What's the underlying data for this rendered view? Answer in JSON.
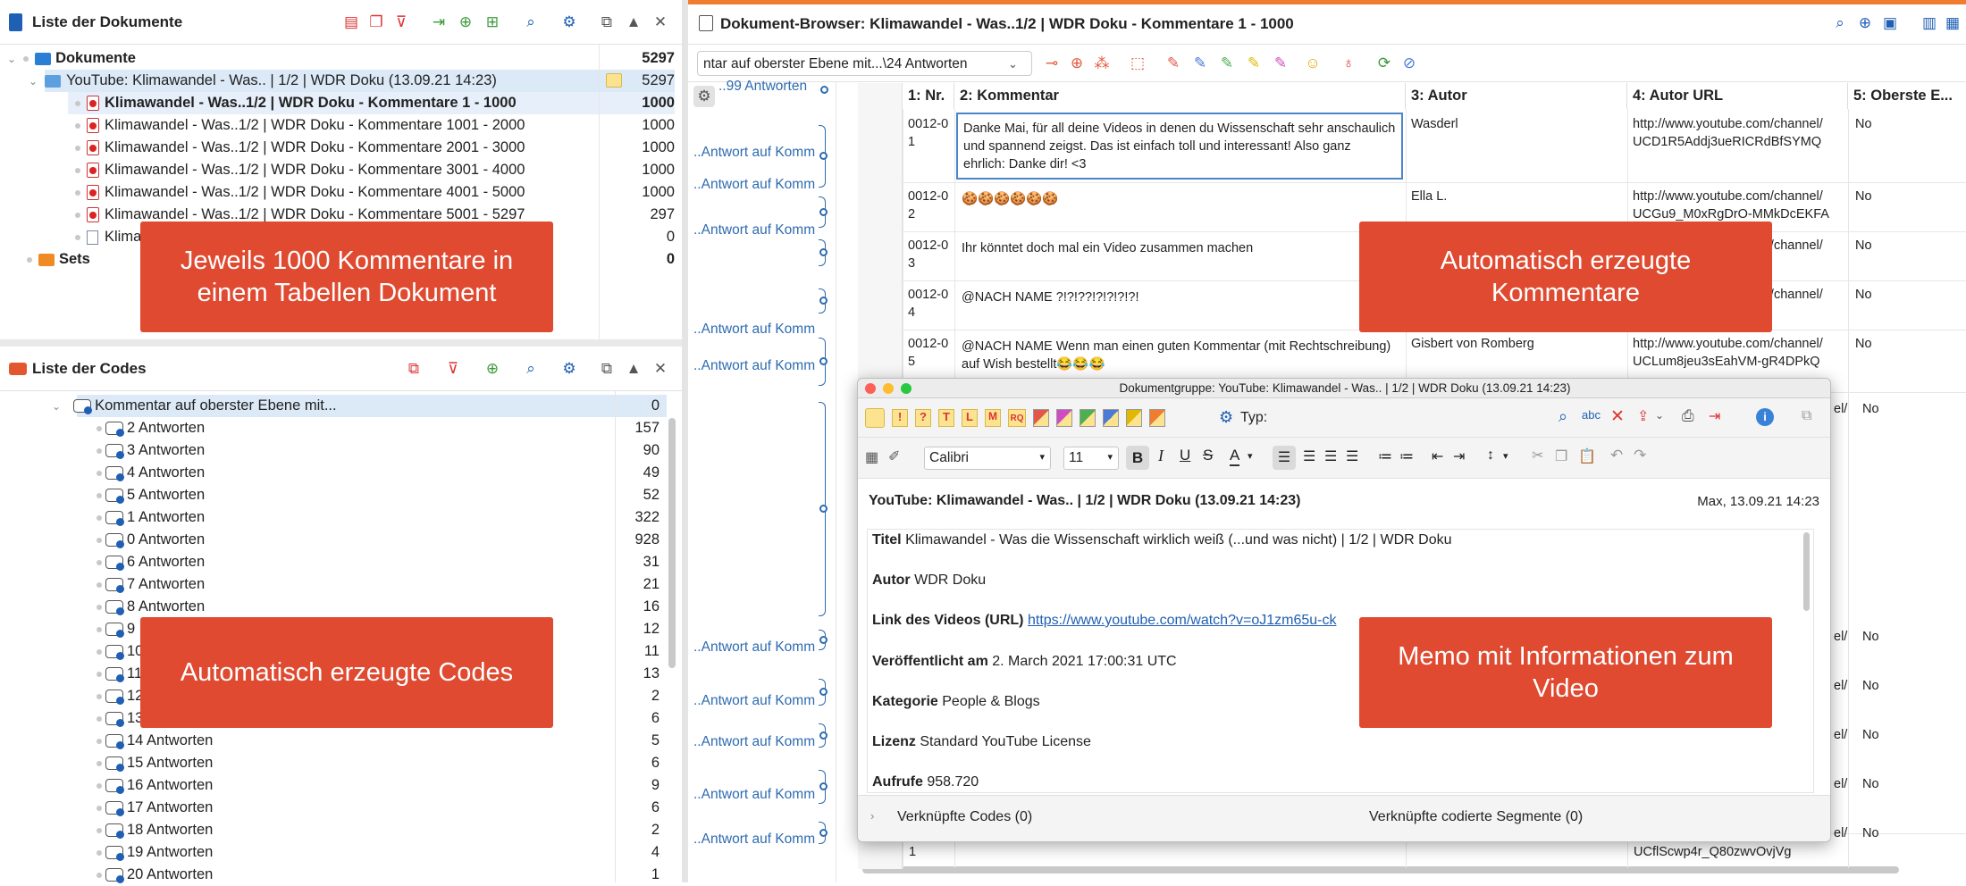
{
  "docs_panel": {
    "title": "Liste der Dokumente"
  },
  "docs_tree": [
    {
      "label": "Dokumente",
      "count": "5297"
    },
    {
      "label": "YouTube: Klimawandel - Was.. | 1/2 | WDR Doku (13.09.21 14:23)",
      "count": "5297"
    },
    {
      "label": "Klimawandel - Was..1/2 | WDR Doku -  Kommentare 1 - 1000",
      "count": "1000"
    },
    {
      "label": "Klimawandel - Was..1/2 | WDR Doku -  Kommentare 1001 - 2000",
      "count": "1000"
    },
    {
      "label": "Klimawandel - Was..1/2 | WDR Doku -  Kommentare 2001 - 3000",
      "count": "1000"
    },
    {
      "label": "Klimawandel - Was..1/2 | WDR Doku -  Kommentare 3001 - 4000",
      "count": "1000"
    },
    {
      "label": "Klimawandel - Was..1/2 | WDR Doku -  Kommentare 4001 - 5000",
      "count": "1000"
    },
    {
      "label": "Klimawandel - Was..1/2 | WDR Doku -  Kommentare 5001 - 5297",
      "count": "297"
    },
    {
      "label": "Klima",
      "count": "0"
    },
    {
      "label": "Sets",
      "count": "0"
    }
  ],
  "codes_panel": {
    "title": "Liste der Codes"
  },
  "codes_tree": [
    {
      "label": "Kommentar auf oberster Ebene mit...",
      "count": "0"
    },
    {
      "label": "2 Antworten",
      "count": "157"
    },
    {
      "label": "3 Antworten",
      "count": "90"
    },
    {
      "label": "4 Antworten",
      "count": "49"
    },
    {
      "label": "5 Antworten",
      "count": "52"
    },
    {
      "label": "1 Antworten",
      "count": "322"
    },
    {
      "label": "0 Antworten",
      "count": "928"
    },
    {
      "label": "6 Antworten",
      "count": "31"
    },
    {
      "label": "7 Antworten",
      "count": "21"
    },
    {
      "label": "8 Antworten",
      "count": "16"
    },
    {
      "label": "9",
      "count": "12"
    },
    {
      "label": "10",
      "count": "11"
    },
    {
      "label": "11",
      "count": "13"
    },
    {
      "label": "12",
      "count": "2"
    },
    {
      "label": "13",
      "count": "6"
    },
    {
      "label": "14 Antworten",
      "count": "5"
    },
    {
      "label": "15 Antworten",
      "count": "6"
    },
    {
      "label": "16 Antworten",
      "count": "9"
    },
    {
      "label": "17 Antworten",
      "count": "6"
    },
    {
      "label": "18 Antworten",
      "count": "2"
    },
    {
      "label": "19 Antworten",
      "count": "4"
    },
    {
      "label": "20 Antworten",
      "count": "1"
    }
  ],
  "browser": {
    "title": "Dokument-Browser: Klimawandel - Was..1/2 | WDR Doku -  Kommentare 1 - 1000",
    "code_select": "ntar auf oberster Ebene mit...\\24 Antworten",
    "margin_first": "..99 Antworten",
    "margin_label": "..Antwort auf Komm",
    "columns": [
      "1: Nr.",
      "2: Kommentar",
      "3: Autor",
      "4: Autor URL",
      "5: Oberste E..."
    ],
    "rows": [
      {
        "idx": "48",
        "nr": "0012-0\n1",
        "text": "Danke Mai, für all deine Videos in denen du Wissenschaft sehr anschaulich und spannend zeigst. Das ist einfach toll und interessant! Also ganz ehrlich: Danke dir! <3",
        "author": "Wasderl",
        "url": "http://www.youtube.com/channel/\nUCD1R5Addj3ueRICRdBfSYMQ",
        "top": "No"
      },
      {
        "idx": "49",
        "nr": "0012-0\n2",
        "text": "🍪🍪🍪🍪🍪🍪",
        "author": "Ella L.",
        "url": "http://www.youtube.com/channel/\nUCGu9_M0xRgDrO-MMkDcEKFA",
        "top": "No"
      },
      {
        "idx": "50",
        "nr": "0012-0\n3",
        "text": "Ihr könntet doch mal ein Video zusammen machen",
        "author": "",
        "url": "http://www.youtube.com/channel/\n5xZAVw",
        "top": "No"
      },
      {
        "idx": "51",
        "nr": "0012-0\n4",
        "text": "@NACH NAME ?!?!??!?!?!?!?!",
        "author": "",
        "url": "http://www.youtube.com/channel/\nHjLkzQ",
        "top": "No"
      },
      {
        "idx": "52",
        "nr": "0012-0\n5",
        "text": "@NACH NAME Wenn man einen guten Kommentar (mit Rechtschreibung) auf Wish bestellt😂😂😂",
        "author": "Gisbert von Romberg",
        "url": "http://www.youtube.com/channel/\nUCLum8jeu3sEahVM-gR4DPkQ",
        "top": "No"
      }
    ],
    "right_fragments": [
      "el/",
      "No",
      "el/",
      "No",
      "el/",
      "No",
      "el/",
      "No",
      "el/",
      "No",
      "el/",
      "No",
      "el/",
      "No"
    ],
    "last_row": {
      "nr": "1",
      "url": "UCflScwp4r_Q80zwvOvjVg"
    }
  },
  "memo": {
    "window_title": "Dokumentgruppe: YouTube: Klimawandel - Was.. | 1/2 | WDR Doku (13.09.21 14:23)",
    "type_label": "Typ:",
    "font_name": "Calibri",
    "font_size": "11",
    "heading": "YouTube: Klimawandel - Was.. | 1/2 | WDR Doku (13.09.21 14:23)",
    "author_date": "Max, 13.09.21 14:23",
    "fields": [
      {
        "key": "Titel",
        "value": "Klimawandel - Was die Wissenschaft wirklich weiß (...und was nicht) | 1/2 | WDR Doku"
      },
      {
        "key": "Autor",
        "value": "WDR Doku"
      },
      {
        "key": "Link des Videos (URL)",
        "value": "https://www.youtube.com/watch?v=oJ1zm65u-ck"
      },
      {
        "key": "Veröffentlicht am",
        "value": "2. March 2021 17:00:31 UTC"
      },
      {
        "key": "Kategorie",
        "value": "People & Blogs"
      },
      {
        "key": "Lizenz",
        "value": "Standard YouTube License"
      },
      {
        "key": "Aufrufe",
        "value": "958.720"
      }
    ],
    "linked_codes": "Verknüpfte Codes (0)",
    "linked_segments": "Verknüpfte codierte Segmente (0)"
  },
  "callouts": {
    "docs": "Jeweils 1000 Kommentare in einem Tabellen Dokument",
    "codes": "Automatisch erzeugte Codes",
    "comments": "Automatisch erzeugte Kommentare",
    "memo": "Memo mit Informationen zum Video"
  },
  "colors": {
    "callout": "#df4a31",
    "accent_orange": "#f07d2f",
    "selection": "#dce9f7",
    "link": "#2d6bb0"
  }
}
